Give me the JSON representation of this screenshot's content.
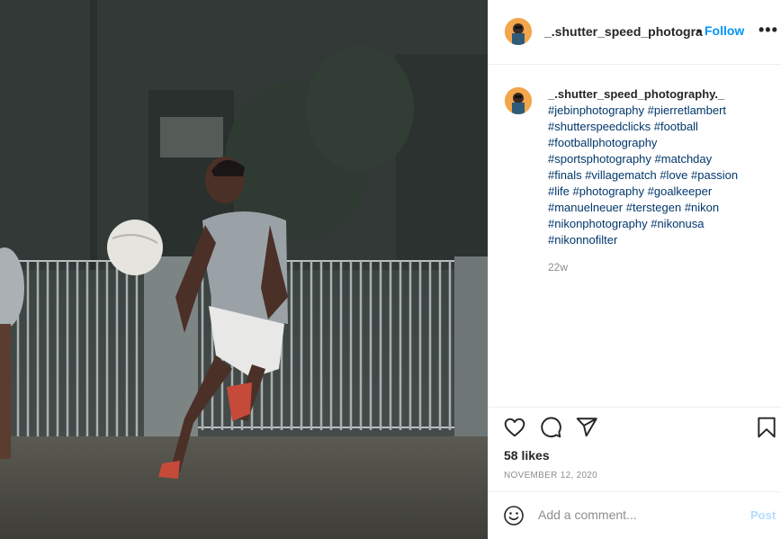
{
  "post": {
    "username": "_.shutter_speed_photogra",
    "separator": "•",
    "follow_label": "Follow",
    "more_label": "•••",
    "caption_username": "_.shutter_speed_photography._",
    "hashtags": [
      "#jebinphotography",
      "#pierretlambert",
      "#shutterspeedclicks",
      "#football",
      "#footballphotography",
      "#sportsphotography",
      "#matchday",
      "#finals",
      "#villagematch",
      "#love",
      "#passion",
      "#life",
      "#photography",
      "#goalkeeper",
      "#manuelneuer",
      "#terstegen",
      "#nikon",
      "#nikonphotography",
      "#nikonusa",
      "#nikonnofilter"
    ],
    "time_ago": "22w",
    "likes": "58 likes",
    "date": "NOVEMBER 12, 2020",
    "comment_placeholder": "Add a comment...",
    "post_label": "Post"
  },
  "icons": {
    "like": "heart-icon",
    "comment": "comment-icon",
    "share": "paper-plane-icon",
    "save": "bookmark-icon",
    "emoji": "emoji-icon"
  },
  "colors": {
    "accent": "#0095f6",
    "hashtag": "#00376b",
    "muted": "#8e8e8e",
    "text": "#262626",
    "post_disabled": "#b3dbff"
  }
}
